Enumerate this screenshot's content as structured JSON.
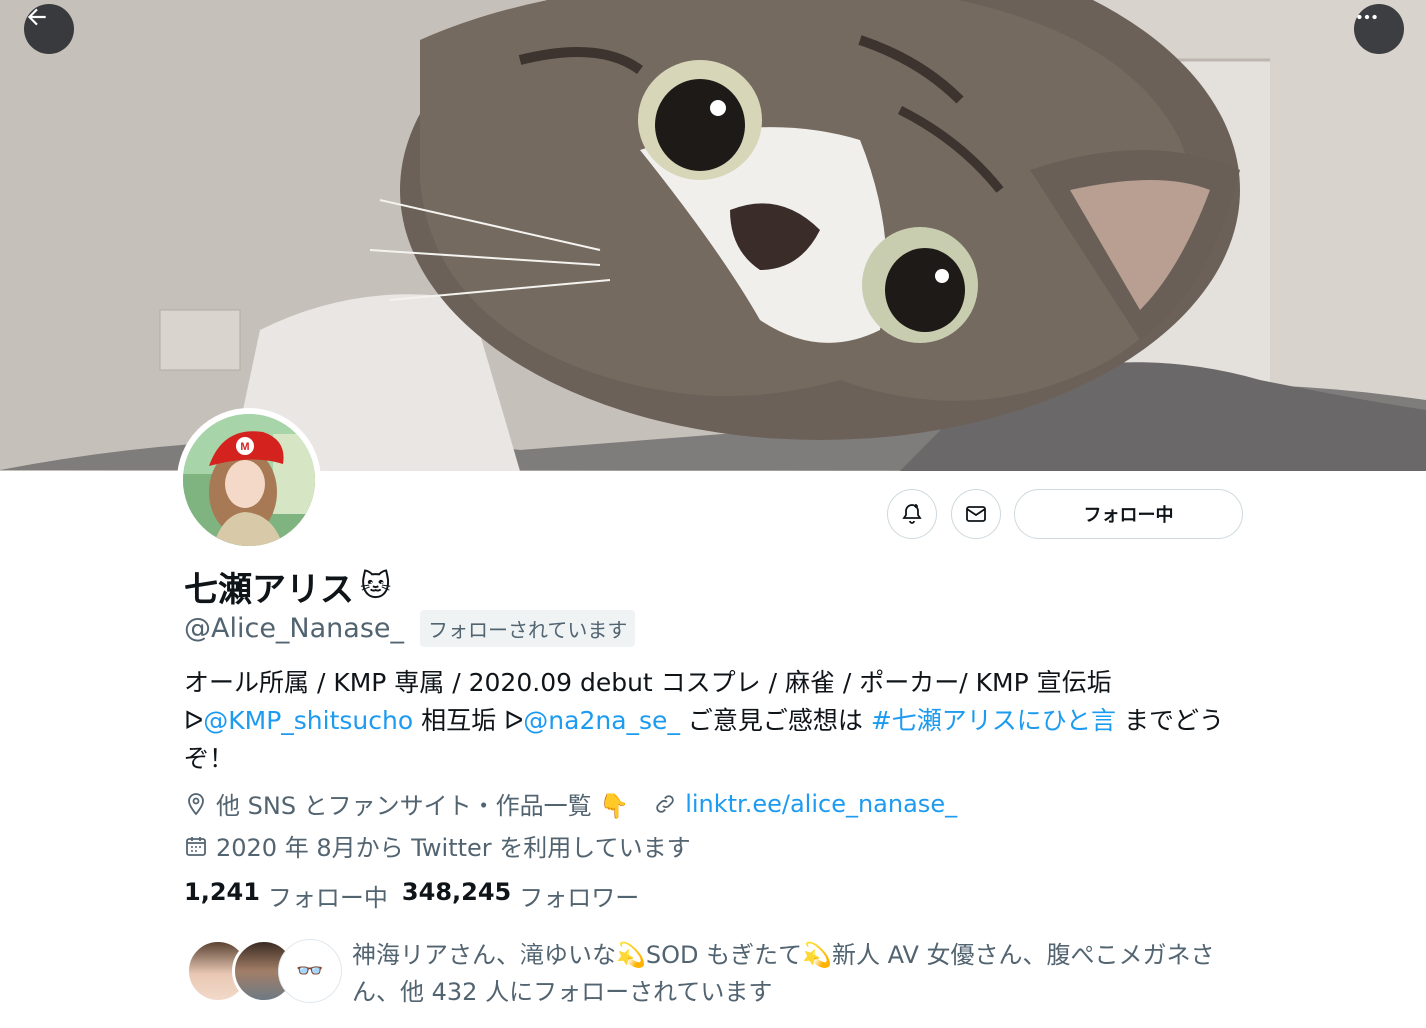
{
  "header": {
    "back_icon": "arrow-left-icon",
    "more_icon": "more-horizontal-icon"
  },
  "profile": {
    "display_name": "七瀬アリス",
    "name_emoji": "🐱",
    "handle": "@Alice_Nanase_",
    "follows_you_badge": "フォローされています",
    "follow_button_label": "フォロー中",
    "notify_icon": "bell-plus-icon",
    "message_icon": "envelope-icon"
  },
  "bio": {
    "line1": "オール所属 / KMP 専属 / 2020.09 debut コスプレ / 麻雀 / ポーカー/ KMP 宣伝垢",
    "arrow1": "ᐅ",
    "mention1": "@KMP_shitsucho",
    "text_mid1": " 相互垢 ",
    "arrow2": "ᐅ",
    "mention2": "@na2na_se_",
    "text_mid2": " ご意見ご感想は ",
    "hashtag": "#七瀬アリスにひと言",
    "text_end": " までどうぞ！"
  },
  "meta": {
    "location_icon": "location-pin-icon",
    "location_text": "他 SNS とファンサイト・作品一覧 👇",
    "link_icon": "link-icon",
    "link_text": "linktr.ee/alice_nanase_",
    "joined_icon": "calendar-icon",
    "joined_text": "2020 年 8月から Twitter を利用しています"
  },
  "stats": {
    "following_count": "1,241",
    "following_label": "フォロー中",
    "followers_count": "348,245",
    "followers_label": "フォロワー"
  },
  "followers_you_know": {
    "text": "神海リアさん、滝ゆいな💫SOD もぎたて💫新人 AV 女優さん、腹ぺこメガネさん、他 432 人にフォローされています",
    "third_face_glyph": "👓"
  },
  "colors": {
    "accent": "#1d9bf0",
    "secondary_text": "#536471",
    "border": "#cfd9de"
  }
}
